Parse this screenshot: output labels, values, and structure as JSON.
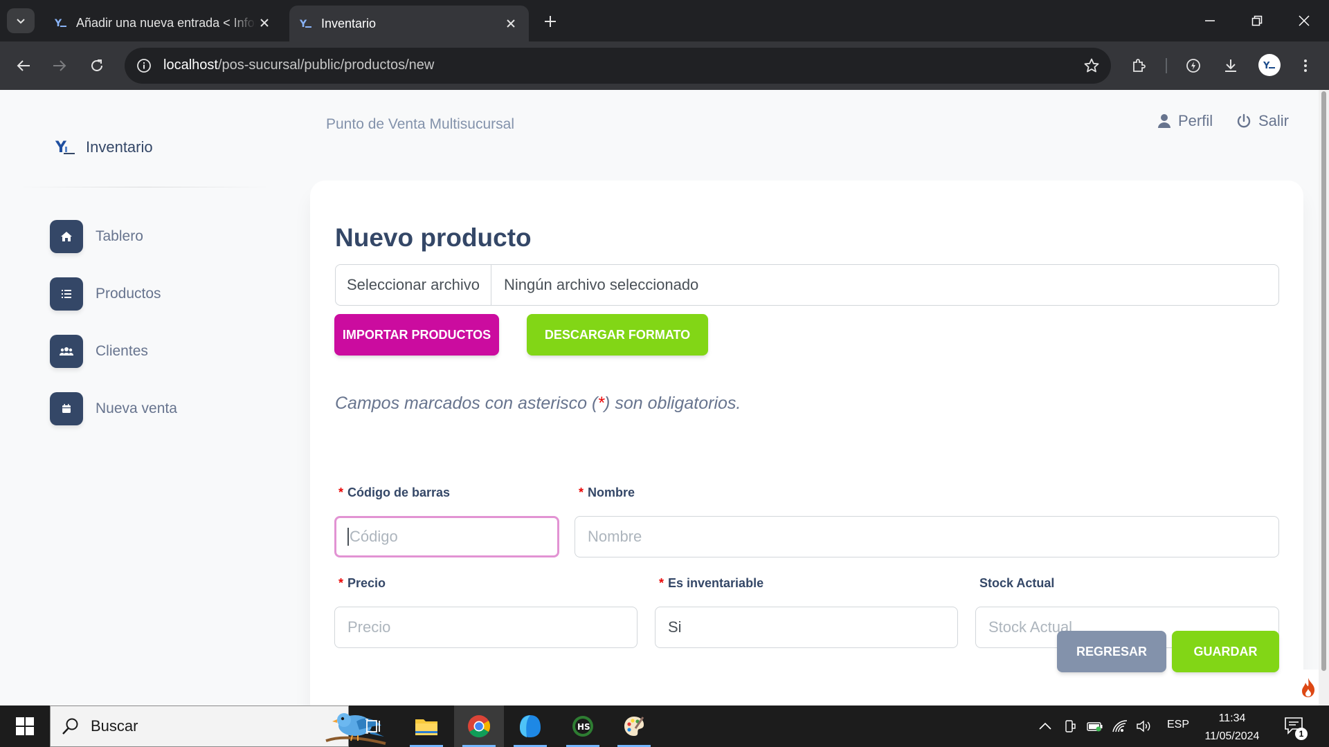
{
  "browser": {
    "tabs": [
      {
        "title": "Añadir una nueva entrada < Información"
      },
      {
        "title": "Inventario"
      }
    ],
    "url_host": "localhost",
    "url_path": "/pos-sucursal/public/productos/new"
  },
  "sidebar": {
    "brand": "Inventario",
    "items": [
      {
        "label": "Tablero",
        "icon": "home-icon"
      },
      {
        "label": "Productos",
        "icon": "list-icon"
      },
      {
        "label": "Clientes",
        "icon": "users-icon"
      },
      {
        "label": "Nueva venta",
        "icon": "calendar-icon"
      }
    ]
  },
  "header": {
    "breadcrumb": "Punto de Venta Multisucursal",
    "profile_label": "Perfil",
    "logout_label": "Salir"
  },
  "form": {
    "title": "Nuevo producto",
    "file_button": "Seleccionar archivo",
    "file_status": "Ningún archivo seleccionado",
    "import_button": "Importar productos",
    "download_button": "Descargar formato",
    "note_before": "Campos marcados con asterisco (",
    "note_asterisk": "*",
    "note_after": ") son obligatorios.",
    "required_mark": "*",
    "fields": {
      "barcode": {
        "label": "Código de barras",
        "placeholder": "Código"
      },
      "name": {
        "label": "Nombre",
        "placeholder": "Nombre"
      },
      "price": {
        "label": "Precio",
        "placeholder": "Precio"
      },
      "inventoriable": {
        "label": "Es inventariable",
        "value": "Si"
      },
      "stock": {
        "label": "Stock Actual",
        "placeholder": "Stock Actual"
      }
    },
    "back_button": "Regresar",
    "save_button": "Guardar"
  },
  "taskbar": {
    "search_placeholder": "Buscar",
    "language": "ESP",
    "time": "11:34",
    "date": "11/05/2024",
    "notification_count": "1"
  },
  "colors": {
    "primary": "#cb0c9f",
    "success": "#82d616",
    "secondary": "#8392ab",
    "dark": "#344767",
    "danger": "#ea0606"
  }
}
